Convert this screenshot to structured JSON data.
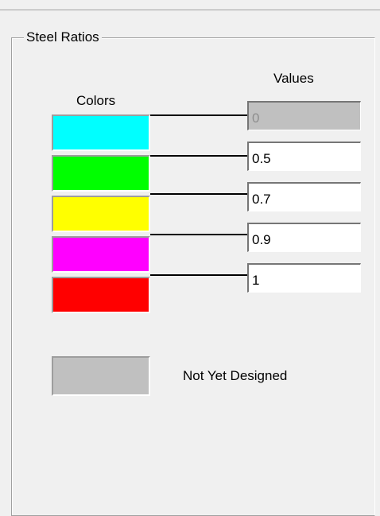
{
  "group": {
    "title": "Steel Ratios"
  },
  "columns": {
    "colors_label": "Colors",
    "values_label": "Values"
  },
  "ratios": [
    {
      "color": "#00ffff",
      "value": "0",
      "editable": false
    },
    {
      "color": "#00ff00",
      "value": "0.5",
      "editable": true
    },
    {
      "color": "#ffff00",
      "value": "0.7",
      "editable": true
    },
    {
      "color": "#ff00ff",
      "value": "0.9",
      "editable": true
    },
    {
      "color": "#ff0000",
      "value": "1",
      "editable": true
    }
  ],
  "not_designed": {
    "color": "#c0c0c0",
    "label": "Not Yet Designed"
  }
}
